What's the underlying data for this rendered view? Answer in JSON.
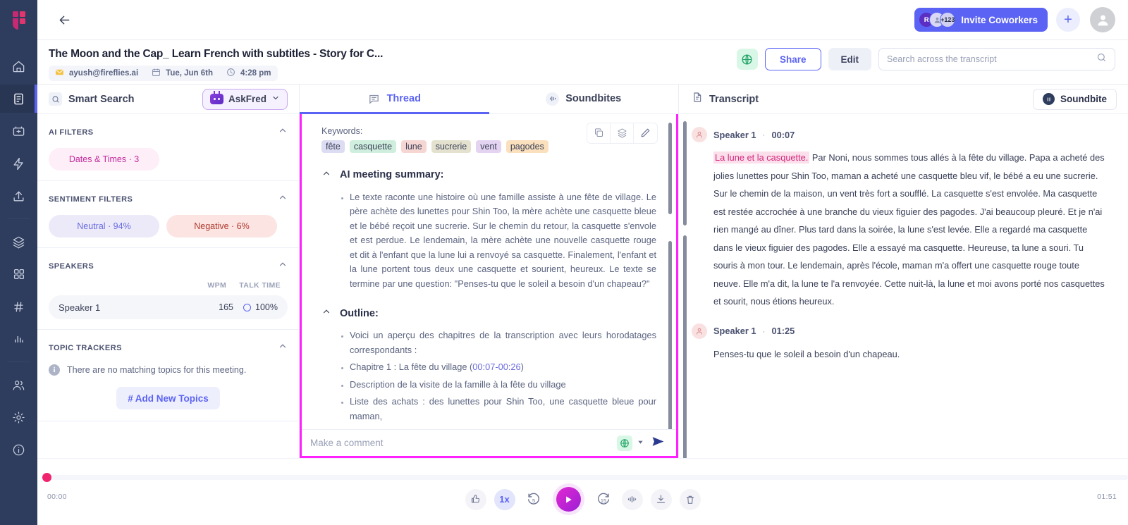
{
  "rail": {
    "logo": "fireflies-logo",
    "items": [
      {
        "name": "home-icon",
        "label": "Home"
      },
      {
        "name": "notes-icon",
        "label": "Notepad"
      },
      {
        "name": "meetings-icon",
        "label": "Meetings"
      },
      {
        "name": "lightning-icon",
        "label": "Automations"
      },
      {
        "name": "upload-icon",
        "label": "Upload"
      },
      {
        "name": "layers-icon",
        "label": "Channels"
      },
      {
        "name": "apps-grid-icon",
        "label": "Apps"
      },
      {
        "name": "hash-icon",
        "label": "Topics"
      },
      {
        "name": "analytics-icon",
        "label": "Analytics"
      },
      {
        "name": "team-icon",
        "label": "Team"
      },
      {
        "name": "gear-icon",
        "label": "Settings"
      },
      {
        "name": "info-icon",
        "label": "Help"
      }
    ]
  },
  "topbar": {
    "back_label": "Back",
    "invite": {
      "label": "Invite Coworkers",
      "avatar_initial": "R",
      "avatar_more": "+123"
    },
    "add_label": "+"
  },
  "meeting": {
    "title": "The Moon and the Cap_ Learn French with subtitles - Story for C...",
    "owner": "ayush@fireflies.ai",
    "date": "Tue, Jun 6th",
    "time": "4:28 pm",
    "share_label": "Share",
    "edit_label": "Edit"
  },
  "search": {
    "placeholder": "Search across the transcript",
    "value": ""
  },
  "left_panel": {
    "header": "Smart Search",
    "askfred_label": "AskFred",
    "sections": {
      "ai_filters": {
        "title": "AI FILTERS",
        "pills": [
          {
            "label": "Dates & Times · 3"
          }
        ]
      },
      "sentiment_filters": {
        "title": "SENTIMENT FILTERS",
        "pills": [
          {
            "label": "Neutral · 94%"
          },
          {
            "label": "Negative · 6%"
          }
        ]
      },
      "speakers": {
        "title": "SPEAKERS",
        "col_wpm": "WPM",
        "col_talk_time": "TALK TIME",
        "rows": [
          {
            "name": "Speaker 1",
            "wpm": "165",
            "talk_time": "100%"
          }
        ]
      },
      "topic_trackers": {
        "title": "TOPIC TRACKERS",
        "empty_text": "There are no matching topics for this meeting.",
        "add_label": "Add New Topics",
        "add_prefix": "#"
      }
    }
  },
  "center_panel": {
    "tabs": [
      {
        "label": "Thread",
        "icon": "thread-icon",
        "active": true
      },
      {
        "label": "Soundbites",
        "icon": "soundbite-icon",
        "active": false
      }
    ],
    "keywords_label": "Keywords:",
    "keywords": [
      {
        "text": "fête",
        "color": "#dcdcf2"
      },
      {
        "text": "casquette",
        "color": "#cfeedd"
      },
      {
        "text": "lune",
        "color": "#f6d6d2"
      },
      {
        "text": "sucrerie",
        "color": "#e4e2cf"
      },
      {
        "text": "vent",
        "color": "#e4d4f2"
      },
      {
        "text": "pagodes",
        "color": "#fae0bd"
      }
    ],
    "tools": [
      {
        "name": "copy-icon"
      },
      {
        "name": "layers-icon"
      },
      {
        "name": "edit-pencil-icon"
      }
    ],
    "summary": {
      "title": "AI meeting summary:",
      "bullets": [
        "Le texte raconte une histoire où une famille assiste à une fête de village. Le père achète des lunettes pour Shin Too, la mère achète une casquette bleue et le bébé reçoit une sucrerie. Sur le chemin du retour, la casquette s'envole et est perdue. Le lendemain, la mère achète une nouvelle casquette rouge et dit à l'enfant que la lune lui a renvoyé sa casquette. Finalement, l'enfant et la lune portent tous deux une casquette et sourient, heureux. Le texte se termine par une question: \"Penses-tu que le soleil a besoin d'un chapeau?\""
      ]
    },
    "outline": {
      "title": "Outline:",
      "bullets": [
        "Voici un aperçu des chapitres de la transcription avec leurs horodatages correspondants :",
        "Chapitre 1 : La fête du village (00:07-00:26)",
        "Description de la visite de la famille à la fête du village",
        "Liste des achats : des lunettes pour Shin Too, une casquette bleue pour maman,"
      ],
      "timestamp_chapter1": "00:07-00:26"
    },
    "comment": {
      "placeholder": "Make a comment",
      "value": ""
    }
  },
  "right_panel": {
    "header": "Transcript",
    "soundbite_label": "Soundbite",
    "utterances": [
      {
        "speaker": "Speaker 1",
        "time": "00:07",
        "highlight": "La lune et la casquette.",
        "text": " Par Noni, nous sommes tous allés à la fête du village. Papa a acheté des jolies lunettes pour Shin Too, maman a acheté une casquette bleu vif, le bébé a eu une sucrerie. Sur le chemin de la maison, un vent très fort a soufflé. La casquette s'est envolée. Ma casquette est restée accrochée à une branche du vieux figuier des pagodes. J'ai beaucoup pleuré. Et je n'ai rien mangé au dîner. Plus tard dans la soirée, la lune s'est levée. Elle a regardé ma casquette dans le vieux figuier des pagodes. Elle a essayé ma casquette. Heureuse, ta lune a souri. Tu souris à mon tour. Le lendemain, après l'école, maman m'a offert une casquette rouge toute neuve. Elle m'a dit, la lune te l'a renvoyée. Cette nuit-là, la lune et moi avons porté nos casquettes et sourit, nous étions heureux."
      },
      {
        "speaker": "Speaker 1",
        "time": "01:25",
        "highlight": "",
        "text": "Penses-tu que le soleil a besoin d'un chapeau."
      }
    ]
  },
  "player": {
    "current_time": "00:00",
    "total_time": "01:51",
    "speed": "1x",
    "rewind": "5",
    "forward": "15",
    "controls": [
      {
        "name": "thumbs-up-icon"
      },
      {
        "name": "playback-speed-button"
      },
      {
        "name": "rewind-5-button"
      },
      {
        "name": "play-button"
      },
      {
        "name": "forward-15-button"
      },
      {
        "name": "waveform-icon"
      },
      {
        "name": "download-icon"
      },
      {
        "name": "delete-icon"
      }
    ]
  },
  "colors": {
    "brand_purple": "#5b63f4",
    "rail_bg": "#2e3c5d",
    "highlight_border": "#ff22ff",
    "play_pink": "#e329d0",
    "progress_knob": "#f0246e"
  }
}
